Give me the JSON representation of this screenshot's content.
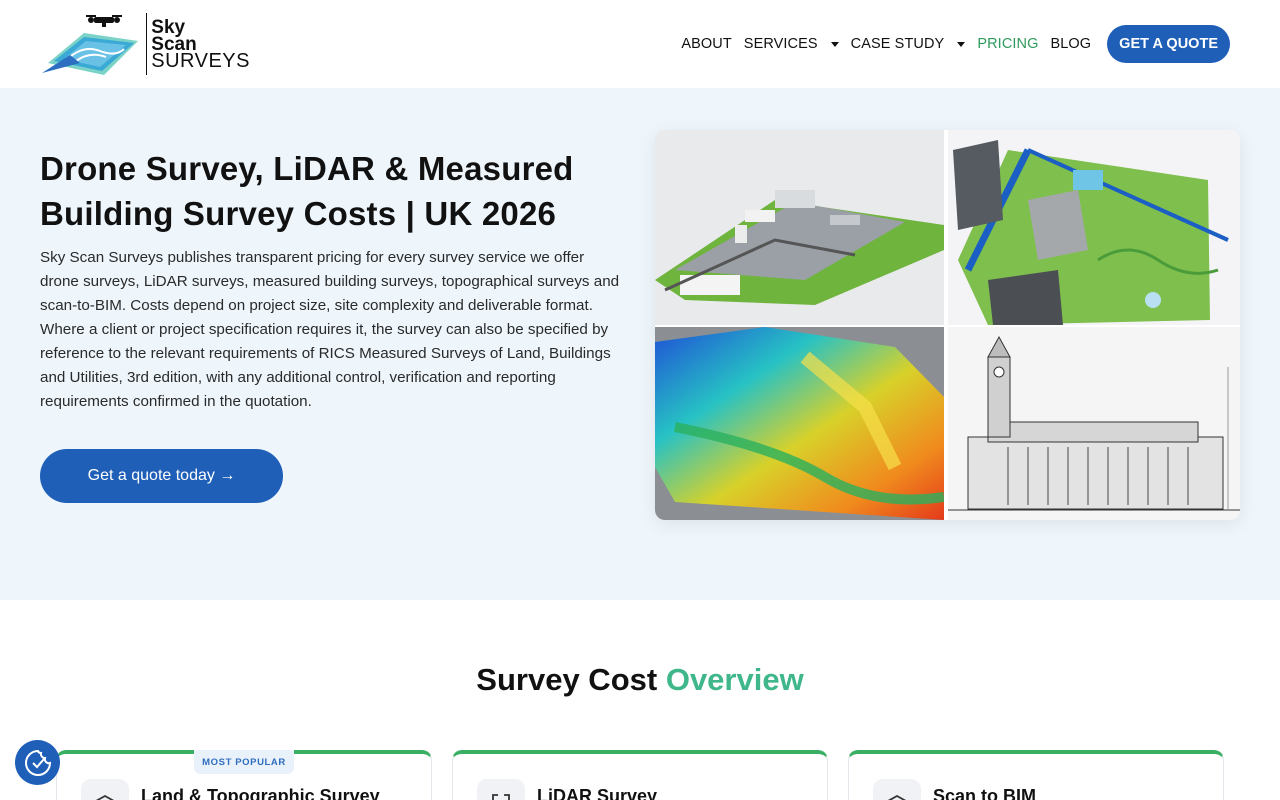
{
  "brand": {
    "line1": "Sky",
    "line2": "Scan",
    "line3": "SURVEYS",
    "accent_color": "#1f5fb8",
    "green_color": "#3aae63"
  },
  "nav": {
    "items": [
      {
        "label": "ABOUT",
        "has_dropdown": false,
        "active": false
      },
      {
        "label": "SERVICES",
        "has_dropdown": true,
        "active": false
      },
      {
        "label": "CASE STUDY",
        "has_dropdown": true,
        "active": false
      },
      {
        "label": "PRICING",
        "has_dropdown": false,
        "active": true
      },
      {
        "label": "BLOG",
        "has_dropdown": false,
        "active": false
      }
    ],
    "cta_label": "GET A QUOTE"
  },
  "hero": {
    "title": "Drone Survey, LiDAR & Measured Building Survey Costs | UK 2026",
    "description": "Sky Scan Surveys publishes transparent pricing for every survey service we offer drone surveys, LiDAR surveys, measured building surveys, topographical surveys and scan-to-BIM. Costs depend on project size, site complexity and deliverable format. Where a client or project specification requires it, the survey can also be specified by reference to the relevant requirements of RICS Measured Surveys of Land, Buildings and Utilities, 3rd edition, with any additional control, verification and reporting requirements confirmed in the quotation.",
    "cta_label": "Get a quote today →"
  },
  "overview": {
    "title_main": "Survey Cost",
    "title_accent": "Overview"
  },
  "cards": [
    {
      "title": "Land & Topographic Survey",
      "badge": "MOST POPULAR",
      "icon": "layers-icon"
    },
    {
      "title": "LiDAR Survey",
      "badge": "",
      "icon": "scan-frame-icon"
    },
    {
      "title": "Scan to BIM",
      "badge": "",
      "icon": "layers-icon"
    }
  ],
  "cookie": {
    "icon": "cookie-consent-icon"
  }
}
